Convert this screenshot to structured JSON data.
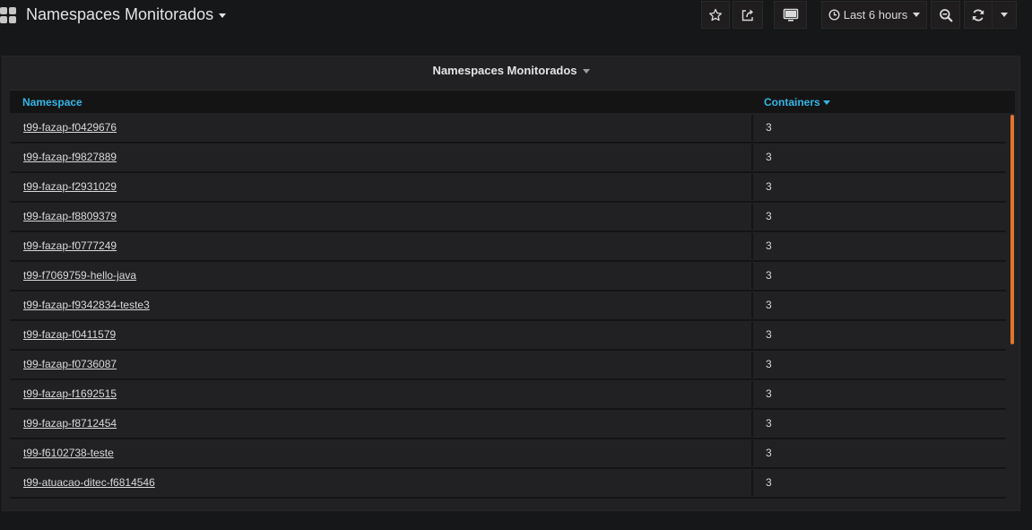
{
  "header": {
    "title": "Namespaces Monitorados",
    "time_range": "Last 6 hours",
    "buttons": [
      {
        "name": "star-button",
        "icon": "star-icon"
      },
      {
        "name": "share-button",
        "icon": "share-icon"
      },
      {
        "name": "tv-mode-button",
        "icon": "monitor-icon"
      },
      {
        "name": "time-picker-button",
        "icon": "clock-icon"
      },
      {
        "name": "zoom-out-button",
        "icon": "zoom-out-icon"
      },
      {
        "name": "refresh-button",
        "icon": "refresh-icon"
      },
      {
        "name": "refresh-interval-button",
        "icon": "caret-down-icon"
      }
    ]
  },
  "panel": {
    "title": "Namespaces Monitorados",
    "columns": {
      "namespace": "Namespace",
      "containers": "Containers"
    },
    "sort": {
      "column": "Containers",
      "direction": "desc"
    },
    "rows": [
      {
        "namespace": "t99-fazap-f0429676",
        "containers": "3"
      },
      {
        "namespace": "t99-fazap-f9827889",
        "containers": "3"
      },
      {
        "namespace": "t99-fazap-f2931029",
        "containers": "3"
      },
      {
        "namespace": "t99-fazap-f8809379",
        "containers": "3"
      },
      {
        "namespace": "t99-fazap-f0777249",
        "containers": "3"
      },
      {
        "namespace": "t99-f7069759-hello-java",
        "containers": "3"
      },
      {
        "namespace": "t99-fazap-f9342834-teste3",
        "containers": "3"
      },
      {
        "namespace": "t99-fazap-f0411579",
        "containers": "3"
      },
      {
        "namespace": "t99-fazap-f0736087",
        "containers": "3"
      },
      {
        "namespace": "t99-fazap-f1692515",
        "containers": "3"
      },
      {
        "namespace": "t99-fazap-f8712454",
        "containers": "3"
      },
      {
        "namespace": "t99-f6102738-teste",
        "containers": "3"
      },
      {
        "namespace": "t99-atuacao-ditec-f6814546",
        "containers": "3"
      }
    ]
  },
  "colors": {
    "background": "#161719",
    "panel": "#212124",
    "accent_link": "#33b5e5",
    "scrollbar": "#e0752d"
  }
}
